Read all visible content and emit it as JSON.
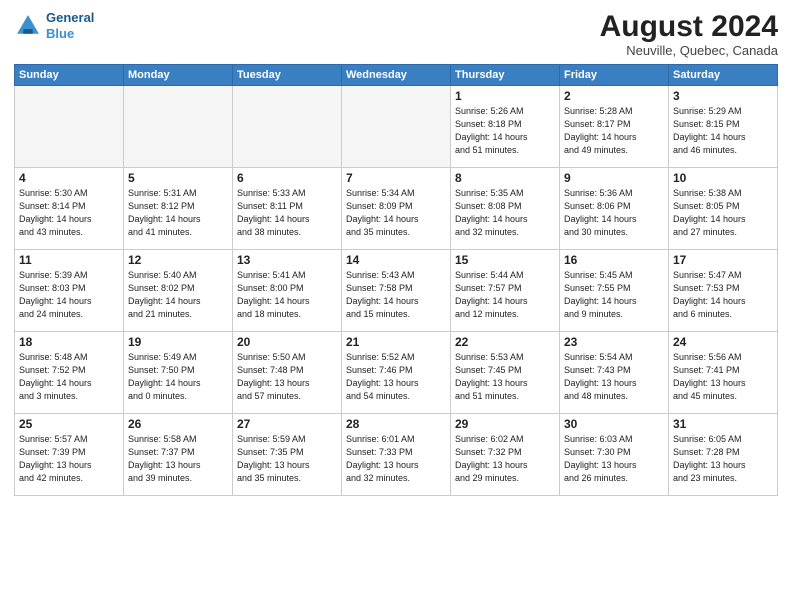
{
  "header": {
    "logo_line1": "General",
    "logo_line2": "Blue",
    "month_year": "August 2024",
    "location": "Neuville, Quebec, Canada"
  },
  "weekdays": [
    "Sunday",
    "Monday",
    "Tuesday",
    "Wednesday",
    "Thursday",
    "Friday",
    "Saturday"
  ],
  "weeks": [
    [
      {
        "day": "",
        "info": ""
      },
      {
        "day": "",
        "info": ""
      },
      {
        "day": "",
        "info": ""
      },
      {
        "day": "",
        "info": ""
      },
      {
        "day": "1",
        "info": "Sunrise: 5:26 AM\nSunset: 8:18 PM\nDaylight: 14 hours\nand 51 minutes."
      },
      {
        "day": "2",
        "info": "Sunrise: 5:28 AM\nSunset: 8:17 PM\nDaylight: 14 hours\nand 49 minutes."
      },
      {
        "day": "3",
        "info": "Sunrise: 5:29 AM\nSunset: 8:15 PM\nDaylight: 14 hours\nand 46 minutes."
      }
    ],
    [
      {
        "day": "4",
        "info": "Sunrise: 5:30 AM\nSunset: 8:14 PM\nDaylight: 14 hours\nand 43 minutes."
      },
      {
        "day": "5",
        "info": "Sunrise: 5:31 AM\nSunset: 8:12 PM\nDaylight: 14 hours\nand 41 minutes."
      },
      {
        "day": "6",
        "info": "Sunrise: 5:33 AM\nSunset: 8:11 PM\nDaylight: 14 hours\nand 38 minutes."
      },
      {
        "day": "7",
        "info": "Sunrise: 5:34 AM\nSunset: 8:09 PM\nDaylight: 14 hours\nand 35 minutes."
      },
      {
        "day": "8",
        "info": "Sunrise: 5:35 AM\nSunset: 8:08 PM\nDaylight: 14 hours\nand 32 minutes."
      },
      {
        "day": "9",
        "info": "Sunrise: 5:36 AM\nSunset: 8:06 PM\nDaylight: 14 hours\nand 30 minutes."
      },
      {
        "day": "10",
        "info": "Sunrise: 5:38 AM\nSunset: 8:05 PM\nDaylight: 14 hours\nand 27 minutes."
      }
    ],
    [
      {
        "day": "11",
        "info": "Sunrise: 5:39 AM\nSunset: 8:03 PM\nDaylight: 14 hours\nand 24 minutes."
      },
      {
        "day": "12",
        "info": "Sunrise: 5:40 AM\nSunset: 8:02 PM\nDaylight: 14 hours\nand 21 minutes."
      },
      {
        "day": "13",
        "info": "Sunrise: 5:41 AM\nSunset: 8:00 PM\nDaylight: 14 hours\nand 18 minutes."
      },
      {
        "day": "14",
        "info": "Sunrise: 5:43 AM\nSunset: 7:58 PM\nDaylight: 14 hours\nand 15 minutes."
      },
      {
        "day": "15",
        "info": "Sunrise: 5:44 AM\nSunset: 7:57 PM\nDaylight: 14 hours\nand 12 minutes."
      },
      {
        "day": "16",
        "info": "Sunrise: 5:45 AM\nSunset: 7:55 PM\nDaylight: 14 hours\nand 9 minutes."
      },
      {
        "day": "17",
        "info": "Sunrise: 5:47 AM\nSunset: 7:53 PM\nDaylight: 14 hours\nand 6 minutes."
      }
    ],
    [
      {
        "day": "18",
        "info": "Sunrise: 5:48 AM\nSunset: 7:52 PM\nDaylight: 14 hours\nand 3 minutes."
      },
      {
        "day": "19",
        "info": "Sunrise: 5:49 AM\nSunset: 7:50 PM\nDaylight: 14 hours\nand 0 minutes."
      },
      {
        "day": "20",
        "info": "Sunrise: 5:50 AM\nSunset: 7:48 PM\nDaylight: 13 hours\nand 57 minutes."
      },
      {
        "day": "21",
        "info": "Sunrise: 5:52 AM\nSunset: 7:46 PM\nDaylight: 13 hours\nand 54 minutes."
      },
      {
        "day": "22",
        "info": "Sunrise: 5:53 AM\nSunset: 7:45 PM\nDaylight: 13 hours\nand 51 minutes."
      },
      {
        "day": "23",
        "info": "Sunrise: 5:54 AM\nSunset: 7:43 PM\nDaylight: 13 hours\nand 48 minutes."
      },
      {
        "day": "24",
        "info": "Sunrise: 5:56 AM\nSunset: 7:41 PM\nDaylight: 13 hours\nand 45 minutes."
      }
    ],
    [
      {
        "day": "25",
        "info": "Sunrise: 5:57 AM\nSunset: 7:39 PM\nDaylight: 13 hours\nand 42 minutes."
      },
      {
        "day": "26",
        "info": "Sunrise: 5:58 AM\nSunset: 7:37 PM\nDaylight: 13 hours\nand 39 minutes."
      },
      {
        "day": "27",
        "info": "Sunrise: 5:59 AM\nSunset: 7:35 PM\nDaylight: 13 hours\nand 35 minutes."
      },
      {
        "day": "28",
        "info": "Sunrise: 6:01 AM\nSunset: 7:33 PM\nDaylight: 13 hours\nand 32 minutes."
      },
      {
        "day": "29",
        "info": "Sunrise: 6:02 AM\nSunset: 7:32 PM\nDaylight: 13 hours\nand 29 minutes."
      },
      {
        "day": "30",
        "info": "Sunrise: 6:03 AM\nSunset: 7:30 PM\nDaylight: 13 hours\nand 26 minutes."
      },
      {
        "day": "31",
        "info": "Sunrise: 6:05 AM\nSunset: 7:28 PM\nDaylight: 13 hours\nand 23 minutes."
      }
    ]
  ]
}
